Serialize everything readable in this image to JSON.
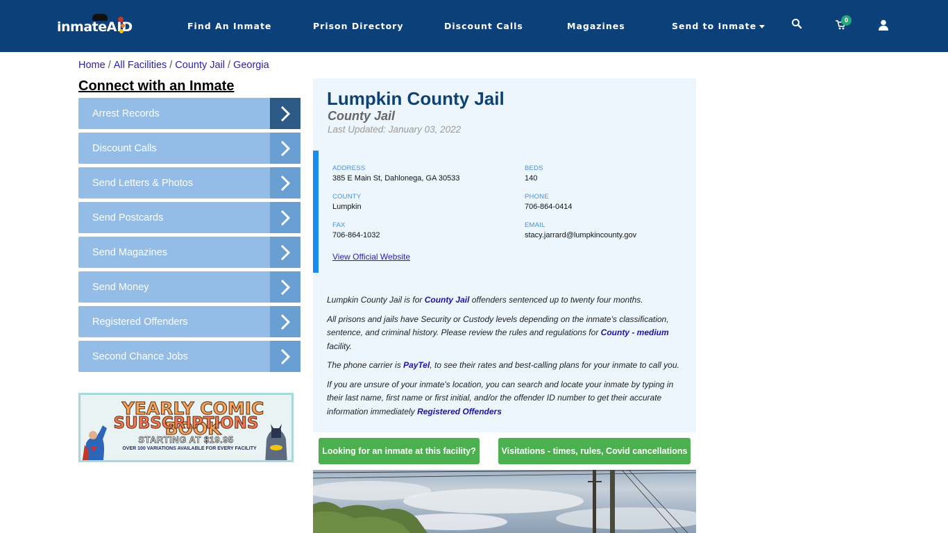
{
  "header": {
    "logo_text": "inmate",
    "logo_suffix": "AID",
    "nav": [
      {
        "label": "Find An Inmate"
      },
      {
        "label": "Prison Directory"
      },
      {
        "label": "Discount Calls"
      },
      {
        "label": "Magazines"
      },
      {
        "label": "Send to Inmate",
        "has_dropdown": true
      }
    ],
    "icons": [
      "search-icon",
      "cart-icon",
      "user-icon"
    ],
    "cart_count": "0",
    "colors": {
      "background": "#0b4178",
      "badge": "#26a67f"
    }
  },
  "breadcrumb": [
    {
      "label": "Home"
    },
    {
      "label": "All Facilities"
    },
    {
      "label": "County Jail"
    },
    {
      "label": "Georgia"
    }
  ],
  "breadcrumb_separator": "/",
  "sidebar": {
    "title": "Connect with an Inmate",
    "items": [
      {
        "label": "Arrest Records"
      },
      {
        "label": "Discount Calls"
      },
      {
        "label": "Send Letters & Photos"
      },
      {
        "label": "Send Postcards"
      },
      {
        "label": "Send Magazines"
      },
      {
        "label": "Send Money"
      },
      {
        "label": "Registered Offenders"
      },
      {
        "label": "Second Chance Jobs"
      }
    ],
    "ad": {
      "line1": "YEARLY COMIC BOOK",
      "line2": "SUBSCRIPTIONS",
      "line3": "STARTING AT $19.95",
      "line4": "OVER 100 VARIATIONS AVAILABLE FOR EVERY FACILITY"
    }
  },
  "facility": {
    "name": "Lumpkin County Jail",
    "type": "County Jail",
    "last_updated": "Last Updated: January 03, 2022",
    "info": {
      "address_label": "ADDRESS",
      "address": "385 E Main St, Dahlonega, GA 30533",
      "beds_label": "BEDS",
      "beds": "140",
      "county_label": "COUNTY",
      "county": "Lumpkin",
      "phone_label": "PHONE",
      "phone": "706-864-0414",
      "fax_label": "FAX",
      "fax": "706-864-1032",
      "email_label": "EMAIL",
      "email": "stacy.jarrard@lumpkincounty.gov",
      "website_link": "View Official Website"
    },
    "description": {
      "p1_a": "Lumpkin County Jail is for ",
      "p1_link": "County Jail",
      "p1_b": " offenders sentenced up to twenty four months.",
      "p2_a": "All prisons and jails have Security or Custody levels depending on the inmate's classification, sentence, and criminal history. Please review the rules and regulations for ",
      "p2_link": "County - medium",
      "p2_b": " facility.",
      "p3_a": "The phone carrier is ",
      "p3_link": "PayTel",
      "p3_b": ", to see their rates and best-calling plans for your inmate to call you.",
      "p4_a": "If you are unsure of your inmate's location, you can search and locate your inmate by typing in their last name, first name or first initial, and/or the offender ID number to get their accurate information immediately ",
      "p4_link": "Registered Offenders"
    }
  },
  "actions": {
    "find_inmate": "Looking for an inmate at this facility?",
    "visitations": "Visitations - times, rules, Covid cancellations"
  }
}
